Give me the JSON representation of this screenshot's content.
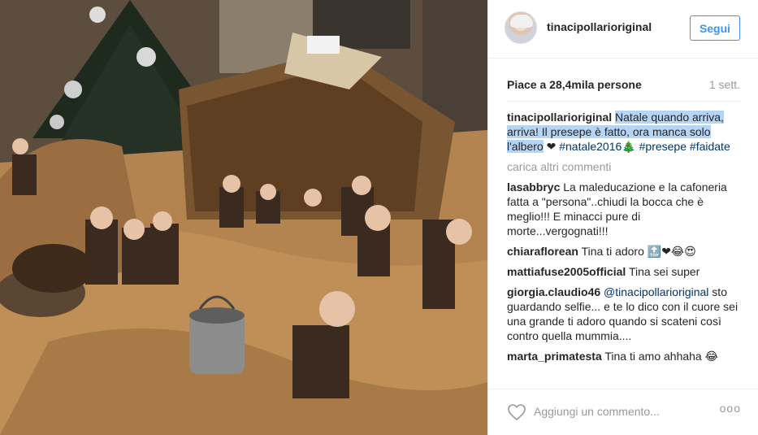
{
  "post": {
    "image_alt": "",
    "username": "tinacipollarioriginal",
    "follow_label": "Segui",
    "likes_text": "Piace a 28,4mila persone",
    "time_ago": "1 sett."
  },
  "caption": {
    "user": "tinacipollarioriginal",
    "highlighted": "Natale quando arriva, arriva! Il presepe è fatto, ora manca solo l'albero",
    "heart": "❤",
    "tag1": "#natale2016",
    "tree": "🎄",
    "tag2": "#presepe",
    "tag3": "#faidate"
  },
  "load_more_label": "carica altri commenti",
  "comments": [
    {
      "user": "lasabbryc",
      "text": "La maleducazione e la cafoneria fatta a \"persona\"..chiudi la bocca che è meglio!!! E minacci pure di morte...vergognati!!!"
    },
    {
      "user": "chiaraflorean",
      "text": "Tina ti adoro 🔝❤😂😍"
    },
    {
      "user": "mattiafuse2005official",
      "text": "Tina sei super"
    },
    {
      "user": "giorgia.claudio46",
      "mention": "@tinacipollarioriginal",
      "text": " sto guardando selfie... e te lo dico con il cuore sei una grande ti adoro quando si scateni così contro quella mummia...."
    },
    {
      "user": "marta_primatesta",
      "text": "Tina ti amo ahhaha 😂"
    }
  ],
  "footer": {
    "placeholder": "Aggiungi un commento...",
    "more_label": "ooo"
  },
  "colors": {
    "accent": "#3897f0",
    "highlight": "#b5d5f7",
    "hashtag": "#003569",
    "muted": "#999999"
  },
  "icons": {
    "like": "heart-outline-icon",
    "more": "more-options-icon"
  }
}
